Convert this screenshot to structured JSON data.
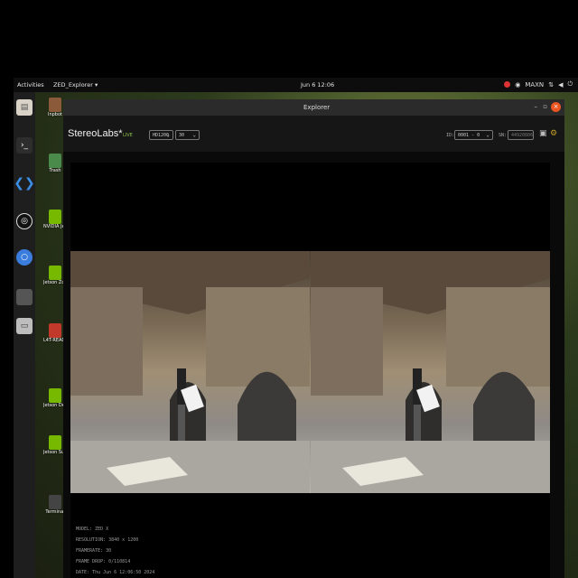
{
  "topbar": {
    "activities": "Activities",
    "app_menu": "ZED_Explorer ▾",
    "clock": "Jun 6  12:06",
    "power_mode": "MAXN"
  },
  "desktop_icons": [
    {
      "label": "Inpbot",
      "color": "#8a5a3a"
    },
    {
      "label": "Trash",
      "color": "#4a8a4a"
    },
    {
      "label": "NVIDIA Jetson Community",
      "color": "#76b900"
    },
    {
      "label": "Jetson Zoo",
      "color": "#76b900"
    },
    {
      "label": "L4T-README",
      "color": "#c0392b"
    },
    {
      "label": "Jetson Developer Z",
      "color": "#76b900"
    },
    {
      "label": "Jetson Supp Forums",
      "color": "#76b900"
    },
    {
      "label": "Terminal",
      "color": "#444444"
    }
  ],
  "window": {
    "title": "Explorer",
    "minimize": "–",
    "maximize": "▫",
    "close": "×"
  },
  "app": {
    "logo": "StereoLabs*",
    "live": "LIVE",
    "resolution": "HD1200",
    "fps": "30",
    "id_label": "ID:",
    "id_value": "0001 - 0",
    "sn_label": "SN:",
    "sn_value": "44920806"
  },
  "info": {
    "model": "MODEL: ZED X",
    "resolution": "RESOLUTION: 3840 x 1200",
    "framerate": "FRAMERATE: 30",
    "frame_drop": "FRAME DROP: 0/110814",
    "date": "DATE: Thu Jun 6 12:06:50 2024"
  },
  "colors": {
    "accent_orange": "#e95420",
    "live_green": "#8bc34a",
    "nvidia_green": "#76b900"
  }
}
